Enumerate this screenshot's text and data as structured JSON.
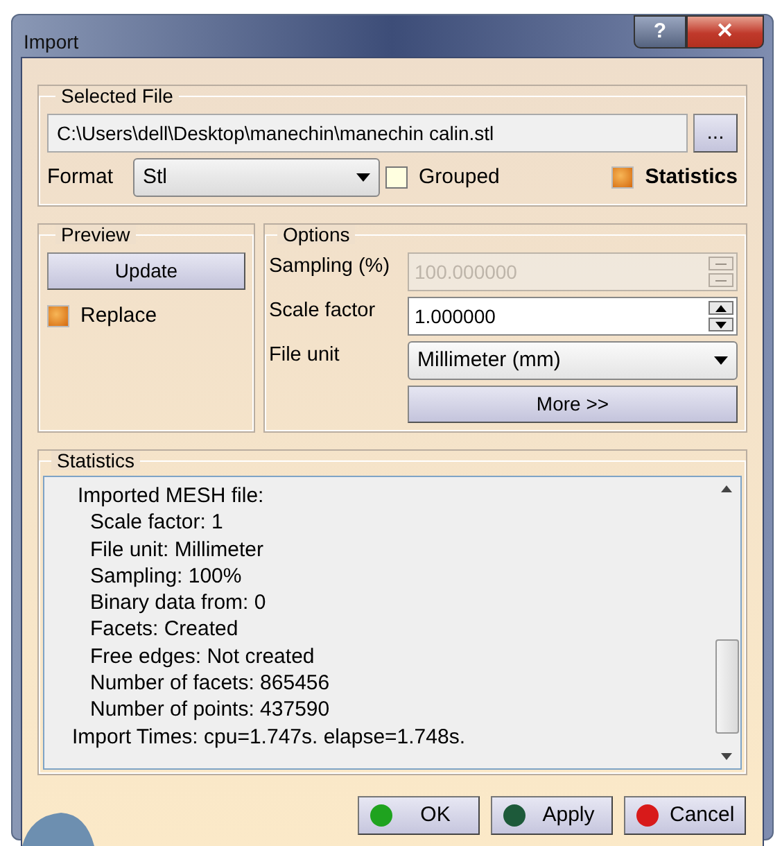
{
  "window": {
    "title": "Import",
    "help_button": "?",
    "close_button": "✕"
  },
  "selected_file": {
    "legend": "Selected File",
    "path": "C:\\Users\\dell\\Desktop\\manechin\\manechin calin.stl",
    "browse_button": "...",
    "format_label": "Format",
    "format_value": "Stl",
    "checkboxes": [
      {
        "label": "Grouped",
        "checked": false
      },
      {
        "label": "Statistics",
        "checked": true
      }
    ]
  },
  "preview": {
    "legend": "Preview",
    "update_button": "Update",
    "replace": {
      "label": "Replace",
      "checked": true
    }
  },
  "options": {
    "legend": "Options",
    "fields": [
      {
        "kind": "spin",
        "label": "Sampling (%)",
        "value": "100.000000",
        "disabled": true
      },
      {
        "kind": "spin",
        "label": "Scale factor",
        "value": "1.000000",
        "disabled": false
      },
      {
        "kind": "select",
        "label": "File unit",
        "value": "Millimeter (mm)"
      }
    ],
    "more_button": "More >>"
  },
  "statistics": {
    "legend": "Statistics",
    "lines": [
      {
        "text": "Imported MESH file:",
        "children": [
          {
            "text": "Scale factor: 1"
          },
          {
            "text": "File unit: Millimeter"
          },
          {
            "text": "Sampling: 100%"
          },
          {
            "text": "Binary data from: 0"
          },
          {
            "text": "Facets: Created"
          },
          {
            "text": "Free edges: Not created"
          },
          {
            "text": "Number of facets: 865456"
          },
          {
            "text": "Number of points: 437590"
          }
        ]
      },
      {
        "text": "Import Times: cpu=1.747s. elapse=1.748s."
      }
    ]
  },
  "buttons": [
    {
      "label": "OK",
      "color": "#1fa31f"
    },
    {
      "label": "Apply",
      "color": "#1d5a3a"
    },
    {
      "label": "Cancel",
      "color": "#d81a1a"
    }
  ]
}
